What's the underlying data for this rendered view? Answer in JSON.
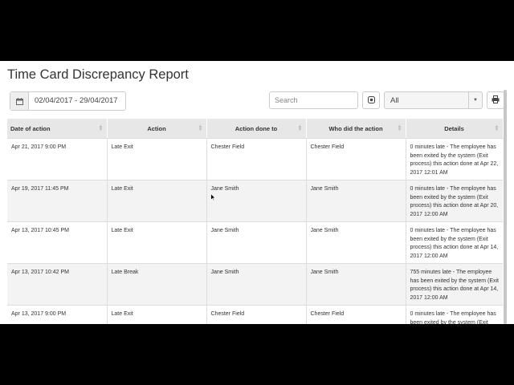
{
  "page": {
    "title": "Time Card Discrepancy Report"
  },
  "toolbar": {
    "date_range": "02/04/2017 - 29/04/2017",
    "search_placeholder": "Search",
    "filter_value": "All"
  },
  "table": {
    "headers": [
      "Date of action",
      "Action",
      "Action done to",
      "Who did the action",
      "Details"
    ],
    "rows": [
      [
        "Apr 21, 2017 9:00 PM",
        "Late Exit",
        "Chester Field",
        "Chester Field",
        "0 minutes late - The employee has been exited by the system (Exit process) this action done at Apr 22, 2017 12:01 AM"
      ],
      [
        "Apr 19, 2017 11:45 PM",
        "Late Exit",
        "Jane Smith",
        "Jane Smith",
        "0 minutes late - The employee has been exited by the system (Exit process) this action done at Apr 20, 2017 12:00 AM"
      ],
      [
        "Apr 13, 2017 10:45 PM",
        "Late Exit",
        "Jane Smith",
        "Jane Smith",
        "0 minutes late - The employee has been exited by the system (Exit process) this action done at Apr 14, 2017 12:00 AM"
      ],
      [
        "Apr 13, 2017 10:42 PM",
        "Late Break",
        "Jane Smith",
        "Jane Smith",
        "755 minutes late - The employee has been exited by the system (Exit process) this action done at Apr 14, 2017 12:00 AM"
      ],
      [
        "Apr 13, 2017 9:00 PM",
        "Late Exit",
        "Chester Field",
        "Chester Field",
        "0 minutes late - The employee has been exited by the system (Exit"
      ]
    ]
  }
}
